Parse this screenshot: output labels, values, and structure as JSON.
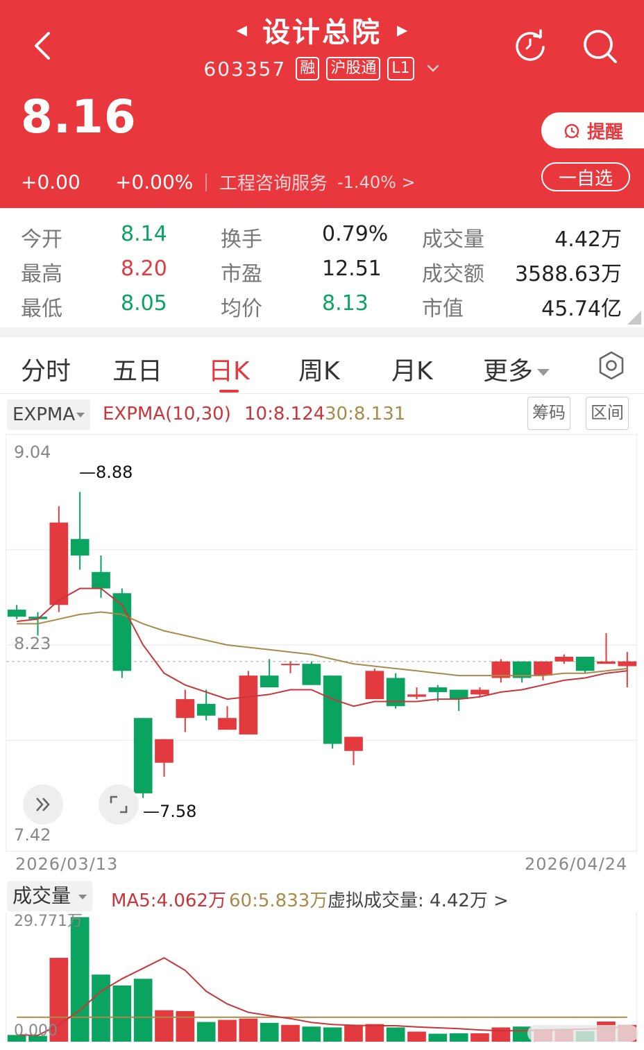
{
  "header": {
    "title": "设计总院",
    "code": "603357",
    "tags": [
      "融",
      "沪股通",
      "L1"
    ],
    "price": "8.16",
    "change": "+0.00",
    "change_pct": "+0.00%",
    "industry": "工程咨询服务",
    "industry_change": "-1.40% >",
    "remind_label": "提醒",
    "watchlist_label": "一自选",
    "colors": {
      "brand_red": "#e8383d",
      "up_red": "#e33a3f",
      "down_green": "#0aa35f"
    }
  },
  "stats": [
    {
      "label": "今开",
      "value": "8.14",
      "tone": "green"
    },
    {
      "label": "换手",
      "value": "0.79%",
      "tone": "neutral"
    },
    {
      "label": "成交量",
      "value": "4.42万",
      "tone": "neutral"
    },
    {
      "label": "最高",
      "value": "8.20",
      "tone": "red"
    },
    {
      "label": "市盈",
      "value": "12.51",
      "tone": "neutral"
    },
    {
      "label": "成交额",
      "value": "3588.63万",
      "tone": "neutral"
    },
    {
      "label": "最低",
      "value": "8.05",
      "tone": "green"
    },
    {
      "label": "均价",
      "value": "8.13",
      "tone": "green"
    },
    {
      "label": "市值",
      "value": "45.74亿",
      "tone": "neutral"
    }
  ],
  "tabs": [
    "分时",
    "五日",
    "日K",
    "周K",
    "月K",
    "更多"
  ],
  "active_tab": "日K",
  "indicator": {
    "select": "EXPMA",
    "name": "EXPMA(10,30)",
    "v10": "10:8.124",
    "v30": "30:8.131",
    "chip_button": "筹码",
    "range_button": "区间"
  },
  "chart_labels": {
    "y_top": "9.04",
    "y_mid": "8.23",
    "y_bottom": "7.42",
    "high_label": "8.88",
    "low_label": "7.58",
    "date_start": "2026/03/13",
    "date_end": "2026/04/24"
  },
  "volume": {
    "select": "成交量",
    "ma5": "MA5:4.062万",
    "ma60": "60:5.833万",
    "virtual": "虚拟成交量: 4.42万 >",
    "max_label": "29.771万",
    "min_label": "0.000"
  },
  "chart_data": {
    "type": "candlestick",
    "ylim": [
      7.42,
      9.04
    ],
    "reference_price": 8.16,
    "candles": [
      {
        "o": 8.38,
        "c": 8.35,
        "h": 8.4,
        "l": 8.34
      },
      {
        "o": 8.35,
        "c": 8.34,
        "h": 8.37,
        "l": 8.27
      },
      {
        "o": 8.4,
        "c": 8.75,
        "h": 8.82,
        "l": 8.37
      },
      {
        "o": 8.68,
        "c": 8.61,
        "h": 8.88,
        "l": 8.55
      },
      {
        "o": 8.54,
        "c": 8.47,
        "h": 8.61,
        "l": 8.43
      },
      {
        "o": 8.45,
        "c": 8.12,
        "h": 8.47,
        "l": 8.09
      },
      {
        "o": 7.92,
        "c": 7.6,
        "h": 7.92,
        "l": 7.58
      },
      {
        "o": 7.73,
        "c": 7.83,
        "h": 7.83,
        "l": 7.67
      },
      {
        "o": 7.92,
        "c": 8.0,
        "h": 8.04,
        "l": 7.86
      },
      {
        "o": 7.98,
        "c": 7.93,
        "h": 8.04,
        "l": 7.91
      },
      {
        "o": 7.87,
        "c": 7.92,
        "h": 7.97,
        "l": 7.87
      },
      {
        "o": 7.85,
        "c": 8.1,
        "h": 8.12,
        "l": 7.85
      },
      {
        "o": 8.1,
        "c": 8.05,
        "h": 8.17,
        "l": 8.05
      },
      {
        "o": 8.15,
        "c": 8.15,
        "h": 8.16,
        "l": 8.11
      },
      {
        "o": 8.15,
        "c": 8.06,
        "h": 8.16,
        "l": 8.06
      },
      {
        "o": 8.1,
        "c": 7.81,
        "h": 8.1,
        "l": 7.79
      },
      {
        "o": 7.78,
        "c": 7.84,
        "h": 7.84,
        "l": 7.72
      },
      {
        "o": 8.0,
        "c": 8.12,
        "h": 8.13,
        "l": 8.0
      },
      {
        "o": 8.09,
        "c": 7.97,
        "h": 8.11,
        "l": 7.96
      },
      {
        "o": 8.01,
        "c": 8.02,
        "h": 8.05,
        "l": 8.0
      },
      {
        "o": 8.05,
        "c": 8.03,
        "h": 8.06,
        "l": 7.99
      },
      {
        "o": 8.04,
        "c": 8.0,
        "h": 8.04,
        "l": 7.95
      },
      {
        "o": 8.02,
        "c": 8.04,
        "h": 8.05,
        "l": 8.01
      },
      {
        "o": 8.09,
        "c": 8.16,
        "h": 8.17,
        "l": 8.07
      },
      {
        "o": 8.16,
        "c": 8.09,
        "h": 8.16,
        "l": 8.07
      },
      {
        "o": 8.1,
        "c": 8.16,
        "h": 8.16,
        "l": 8.08
      },
      {
        "o": 8.16,
        "c": 8.18,
        "h": 8.19,
        "l": 8.15
      },
      {
        "o": 8.18,
        "c": 8.12,
        "h": 8.18,
        "l": 8.11
      },
      {
        "o": 8.15,
        "c": 8.16,
        "h": 8.28,
        "l": 8.15
      },
      {
        "o": 8.14,
        "c": 8.16,
        "h": 8.2,
        "l": 8.05
      }
    ],
    "ema10": [
      8.33,
      8.34,
      8.42,
      8.47,
      8.47,
      8.4,
      8.23,
      8.11,
      8.06,
      8.03,
      8.0,
      8.01,
      8.02,
      8.04,
      8.04,
      8.0,
      7.97,
      7.99,
      7.99,
      7.99,
      8.0,
      8.0,
      8.01,
      8.03,
      8.04,
      8.06,
      8.08,
      8.09,
      8.11,
      8.12
    ],
    "ema30": [
      8.32,
      8.32,
      8.34,
      8.36,
      8.37,
      8.36,
      8.32,
      8.29,
      8.27,
      8.25,
      8.23,
      8.22,
      8.21,
      8.2,
      8.19,
      8.17,
      8.15,
      8.14,
      8.13,
      8.12,
      8.11,
      8.1,
      8.1,
      8.1,
      8.1,
      8.1,
      8.11,
      8.11,
      8.12,
      8.13
    ],
    "volume": {
      "max": 29.771,
      "values": [
        1.6,
        1.4,
        20.0,
        29.7,
        16.0,
        13.4,
        15.0,
        7.5,
        7.3,
        4.7,
        5.2,
        5.5,
        4.5,
        4.0,
        3.6,
        3.4,
        4.0,
        4.2,
        3.4,
        2.4,
        1.9,
        2.0,
        2.0,
        3.4,
        3.6,
        3.0,
        2.8,
        2.5,
        4.8,
        4.0
      ],
      "ma5": [
        1.6,
        1.5,
        4.0,
        7.5,
        12.0,
        15.0,
        17.5,
        20.0,
        17.0,
        12.0,
        9.0,
        7.0,
        6.2,
        5.5,
        4.6,
        4.1,
        3.9,
        3.8,
        3.8,
        3.5,
        3.3,
        3.1,
        2.8,
        2.6,
        2.6,
        2.8,
        2.9,
        3.0,
        3.2,
        3.6
      ],
      "ma60": [
        5.83,
        5.83,
        5.83,
        5.83,
        5.83,
        5.83,
        5.83,
        5.83,
        5.83,
        5.83,
        5.83,
        5.83,
        5.83,
        5.83,
        5.83,
        5.83,
        5.83,
        5.83,
        5.83,
        5.83,
        5.83,
        5.83,
        5.83,
        5.83,
        5.83,
        5.83,
        5.83,
        5.83,
        5.83,
        5.83
      ]
    }
  }
}
